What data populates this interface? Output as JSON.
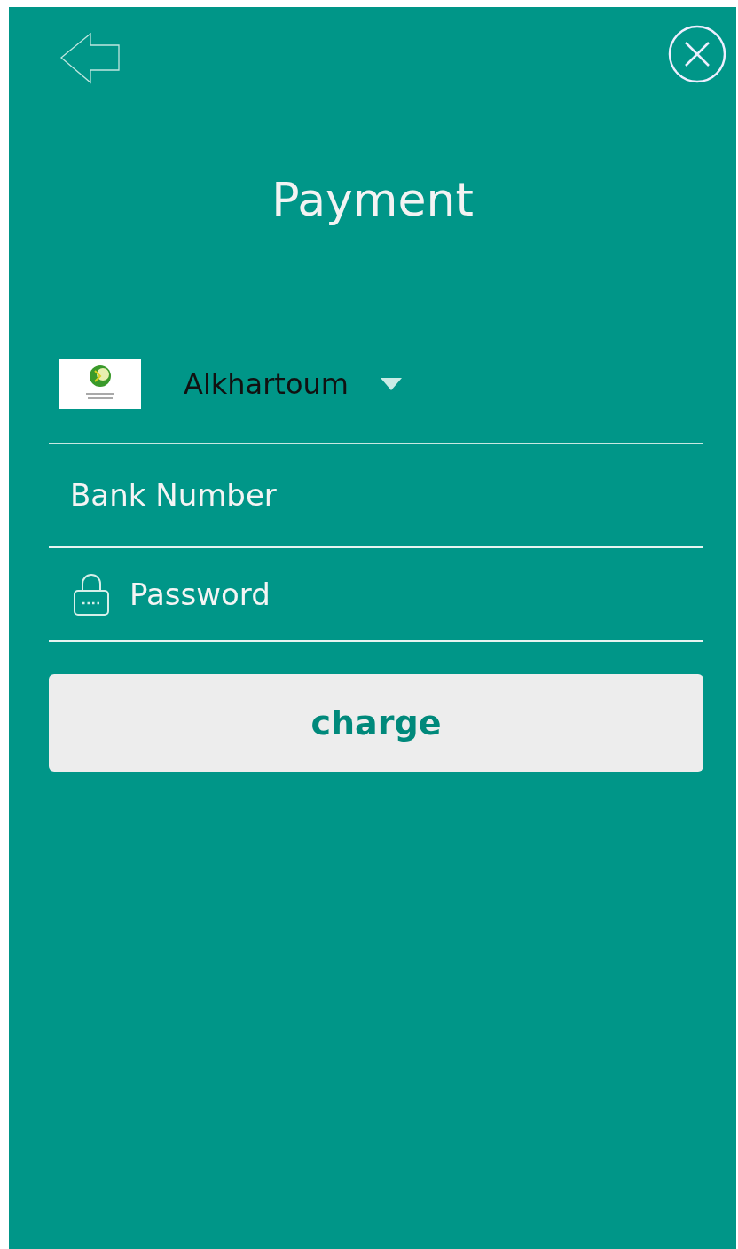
{
  "title": "Payment",
  "bank_select": {
    "value": "Alkhartoum"
  },
  "fields": [
    {
      "kind": "text",
      "placeholder": "Bank Number"
    },
    {
      "kind": "password",
      "placeholder": "Password"
    }
  ],
  "button": "charge"
}
